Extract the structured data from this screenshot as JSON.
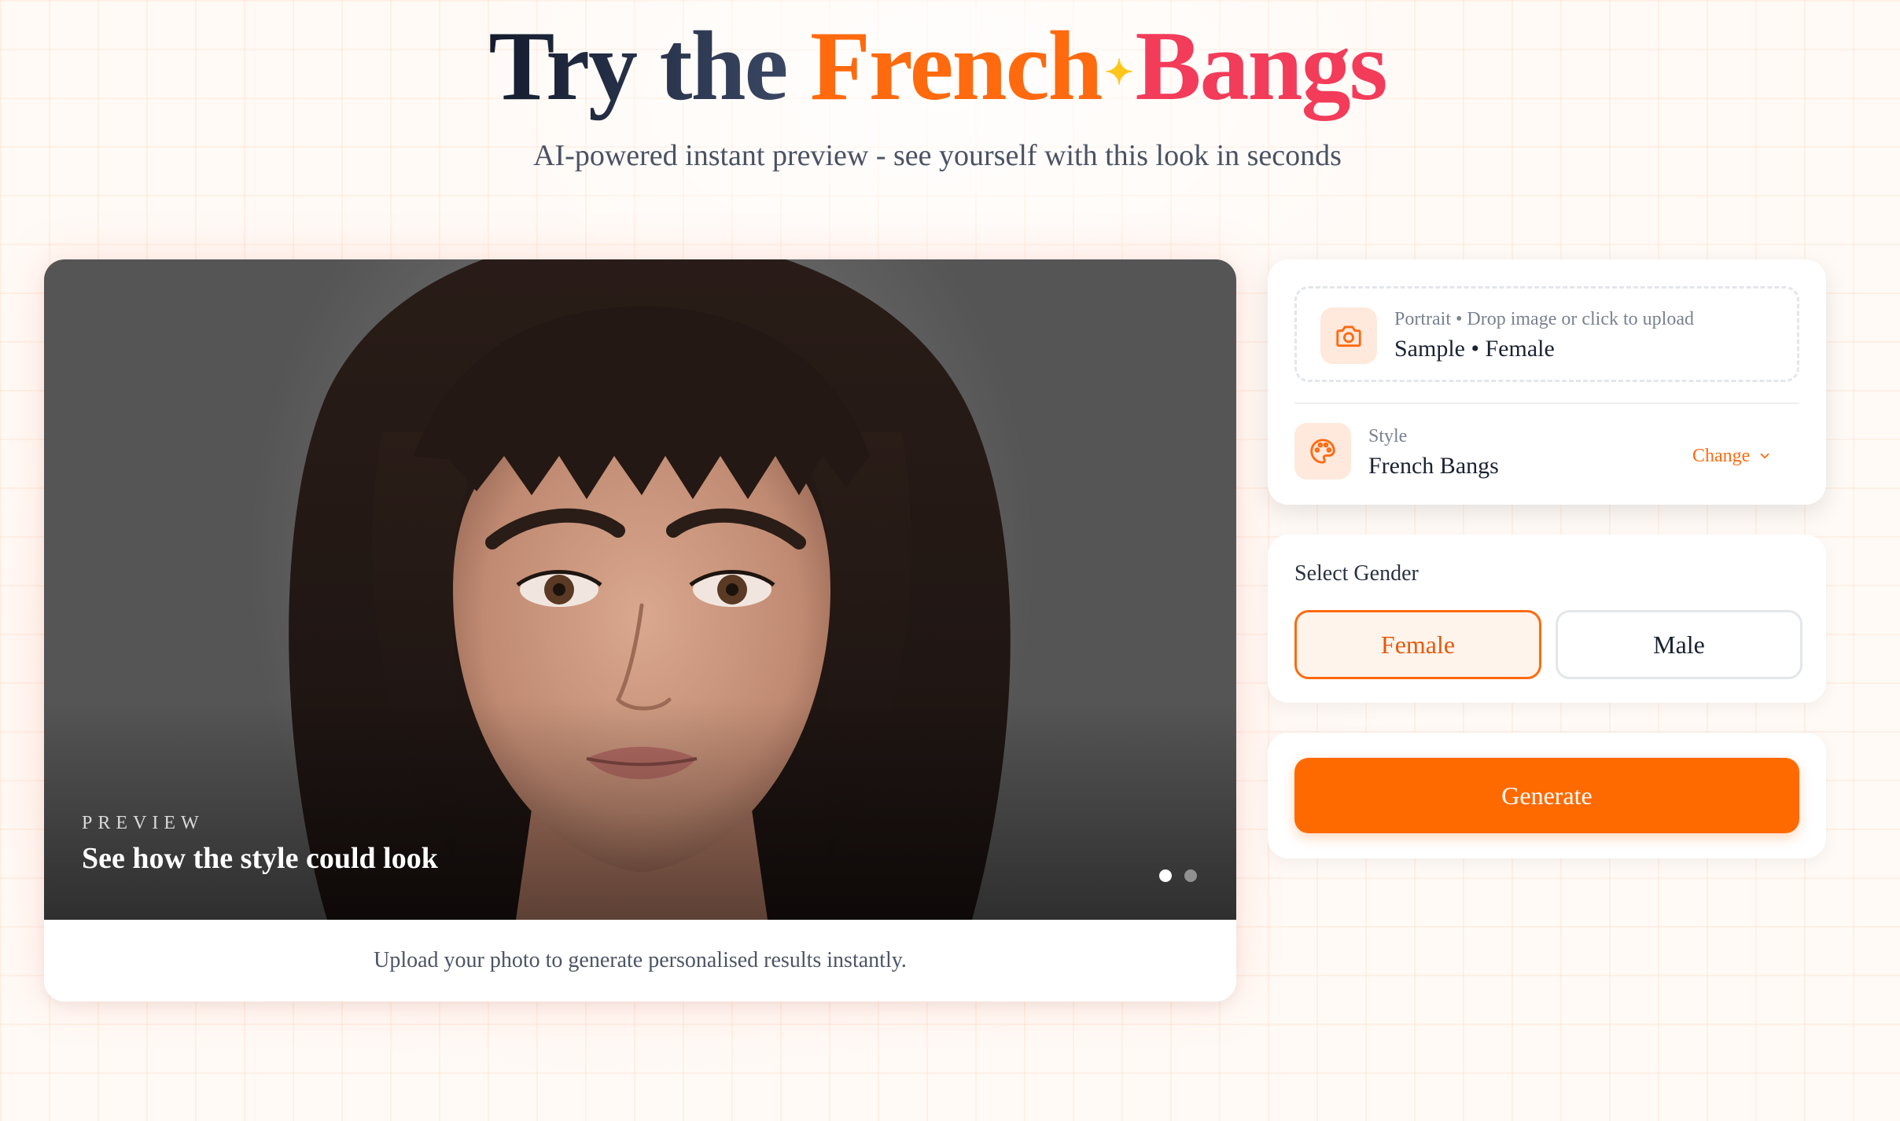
{
  "hero": {
    "title_lead": "Try the",
    "title_accent_1": "French",
    "title_accent_2": "Bangs",
    "subtitle": "AI-powered instant preview - see yourself with this look in seconds"
  },
  "preview": {
    "eyebrow": "PREVIEW",
    "headline": "See how the style could look",
    "caption": "Upload your photo to generate personalised results instantly.",
    "slides": {
      "count": 2,
      "active_index": 0
    }
  },
  "upload": {
    "icon": "camera-icon",
    "hint": "Portrait • Drop image or click to upload",
    "value": "Sample • Female"
  },
  "style": {
    "icon": "palette-icon",
    "label": "Style",
    "value": "French Bangs",
    "change_label": "Change"
  },
  "gender": {
    "label": "Select Gender",
    "options": [
      "Female",
      "Male"
    ],
    "selected": "Female"
  },
  "generate": {
    "label": "Generate"
  },
  "colors": {
    "accent": "#ff6a0f",
    "accent_pink": "#f23c5a",
    "sparkle": "#ffc61a",
    "generate_bg": "#ff6a00"
  }
}
